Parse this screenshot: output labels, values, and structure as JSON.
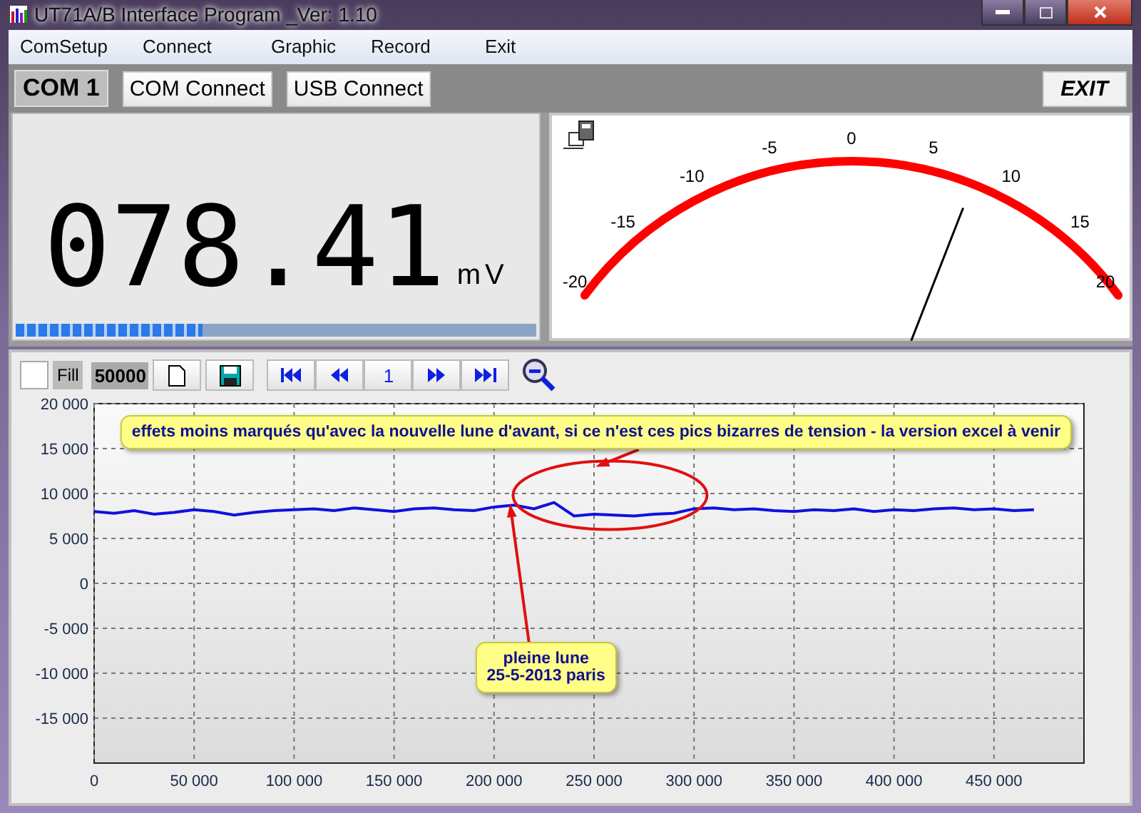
{
  "window": {
    "title": "UT71A/B Interface Program _Ver: 1.10"
  },
  "menu": [
    "ComSetup",
    "Connect",
    "Graphic",
    "Record",
    "Exit"
  ],
  "toolbar": {
    "com_port": "COM 1",
    "buttons": [
      "COM Connect",
      "USB Connect"
    ],
    "exit": "EXIT"
  },
  "display": {
    "reading": "078.41",
    "unit": "mV",
    "level": 0.36
  },
  "gauge": {
    "scale": [
      "-20",
      "-15",
      "-10",
      "-5",
      "0",
      "5",
      "10",
      "15",
      "20"
    ],
    "level": 0.7
  },
  "chart_toolbar": {
    "fill": {
      "label": "Fill",
      "checked": false
    },
    "points": "50000",
    "page": "1"
  },
  "chart": {
    "chart_data": {
      "type": "line",
      "x": [
        0,
        10000,
        20000,
        30000,
        40000,
        50000,
        60000,
        70000,
        80000,
        90000,
        100000,
        110000,
        120000,
        130000,
        140000,
        150000,
        160000,
        170000,
        180000,
        190000,
        200000,
        210000,
        220000,
        230000,
        240000,
        250000,
        260000,
        270000,
        280000,
        290000,
        300000,
        310000,
        320000,
        330000,
        340000,
        350000,
        360000,
        370000,
        380000,
        390000,
        400000,
        410000,
        420000,
        430000,
        440000,
        450000,
        460000,
        470000
      ],
      "grid": true,
      "series": [
        {
          "color": "#1010e0",
          "values": [
            8000,
            7800,
            8100,
            7700,
            7900,
            8200,
            8000,
            7600,
            7900,
            8100,
            8200,
            8300,
            8100,
            8400,
            8200,
            8000,
            8300,
            8400,
            8200,
            8100,
            8500,
            8700,
            8300,
            9000,
            7500,
            7700,
            7600,
            7500,
            7700,
            7800,
            8300,
            8400,
            8200,
            8300,
            8100,
            8000,
            8200,
            8100,
            8300,
            8000,
            8200,
            8100,
            8300,
            8400,
            8200,
            8300,
            8100,
            8200
          ]
        }
      ],
      "xlim": [
        0,
        495000
      ],
      "ylim": [
        -20000,
        20000
      ],
      "xticks": [
        {
          "value": 0,
          "label": "0"
        },
        {
          "value": 50000,
          "label": "50 000"
        },
        {
          "value": 100000,
          "label": "100 000"
        },
        {
          "value": 150000,
          "label": "150 000"
        },
        {
          "value": 200000,
          "label": "200 000"
        },
        {
          "value": 250000,
          "label": "250 000"
        },
        {
          "value": 300000,
          "label": "300 000"
        },
        {
          "value": 350000,
          "label": "350 000"
        },
        {
          "value": 400000,
          "label": "400 000"
        },
        {
          "value": 450000,
          "label": "450 000"
        }
      ],
      "yticks": [
        {
          "value": 20000,
          "label": "20 000"
        },
        {
          "value": 15000,
          "label": "15 000"
        },
        {
          "value": 10000,
          "label": "10 000"
        },
        {
          "value": 5000,
          "label": "5 000"
        },
        {
          "value": 0,
          "label": "0"
        },
        {
          "value": -5000,
          "label": "-5 000"
        },
        {
          "value": -10000,
          "label": "-10 000"
        },
        {
          "value": -15000,
          "label": "-15 000"
        }
      ],
      "annotations": [
        "effets moins marqués qu'avec la nouvelle lune d'avant, si ce n'est ces pics bizarres de tension - la version excel à venir",
        "pleine lune\n25-5-2013 paris"
      ]
    }
  }
}
